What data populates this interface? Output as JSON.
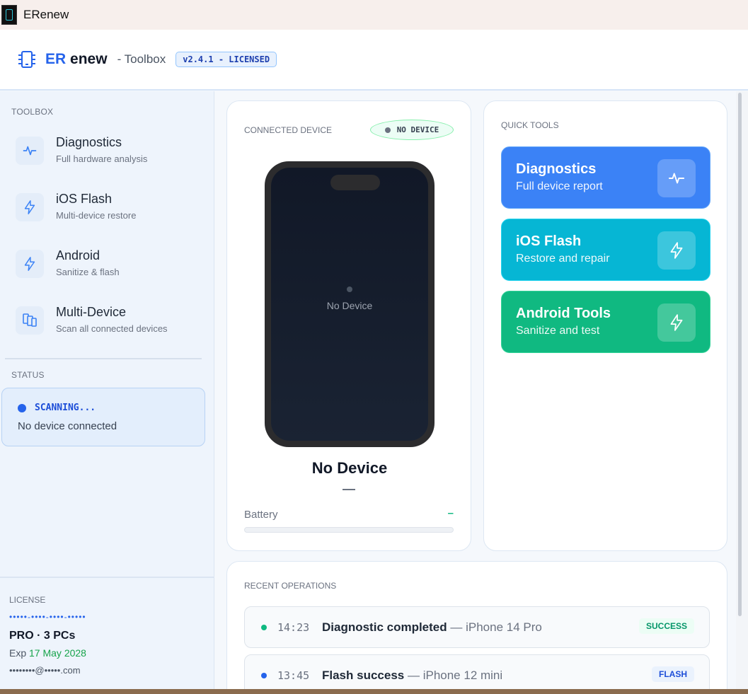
{
  "window": {
    "title": "ERenew"
  },
  "header": {
    "brand_accent": "ER",
    "brand_rest": "enew",
    "subtitle": "- Toolbox",
    "version_badge": "v2.4.1 - LICENSED"
  },
  "sidebar": {
    "heading": "TOOLBOX",
    "items": [
      {
        "label": "Diagnostics",
        "desc": "Full hardware analysis",
        "icon": "pulse-icon"
      },
      {
        "label": "iOS Flash",
        "desc": "Multi-device restore",
        "icon": "lightning-icon"
      },
      {
        "label": "Android",
        "desc": "Sanitize & flash",
        "icon": "lightning-icon"
      },
      {
        "label": "Multi-Device",
        "desc": "Scan all connected devices",
        "icon": "devices-icon"
      }
    ],
    "status_heading": "STATUS",
    "status": {
      "state": "SCANNING...",
      "message": "No device connected"
    },
    "license": {
      "heading": "LICENSE",
      "key": "•••••-••••-••••-•••••",
      "plan": "PRO · 3 PCs",
      "exp_prefix": "Exp",
      "exp_date": "17 May 2028",
      "email": "••••••••@•••••.com"
    }
  },
  "device_panel": {
    "heading": "CONNECTED DEVICE",
    "badge": "NO DEVICE",
    "screen_label": "No Device",
    "device_name": "No Device",
    "battery_label": "Battery",
    "battery_value": "–"
  },
  "quick_tools": {
    "heading": "QUICK TOOLS",
    "tools": [
      {
        "label": "Diagnostics",
        "desc": "Full device report",
        "icon": "pulse-icon",
        "color": "#3b82f6"
      },
      {
        "label": "iOS Flash",
        "desc": "Restore and repair",
        "icon": "lightning-icon",
        "color": "#06b6d4"
      },
      {
        "label": "Android Tools",
        "desc": "Sanitize and test",
        "icon": "lightning-icon",
        "color": "#10b981"
      }
    ]
  },
  "recent_operations": {
    "heading": "RECENT OPERATIONS",
    "items": [
      {
        "time": "14:23",
        "title": "Diagnostic completed",
        "device": "— iPhone 14 Pro",
        "badge": "SUCCESS",
        "dot_color": "#10b981",
        "badge_bg": "#ecfdf5",
        "badge_color": "#059669"
      },
      {
        "time": "13:45",
        "title": "Flash success",
        "device": "— iPhone 12 mini",
        "badge": "FLASH",
        "dot_color": "#2563eb",
        "badge_bg": "#eaf2fd",
        "badge_color": "#1d4ed8"
      }
    ]
  },
  "colors": {
    "accent": "#2563eb",
    "success": "#10b981"
  }
}
